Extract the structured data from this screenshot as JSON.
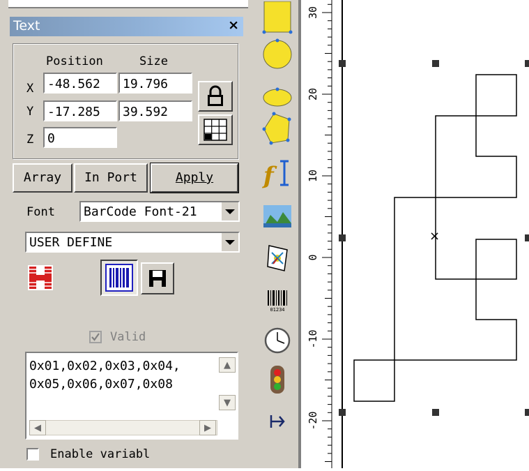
{
  "panel": {
    "title": "Text",
    "close": "×",
    "position_header": "Position",
    "size_header": "Size",
    "x_label": "X",
    "y_label": "Y",
    "z_label": "Z",
    "x_position": "-48.562",
    "x_size": "19.796",
    "y_position": "-17.285",
    "y_size": "39.592",
    "z_value": "0",
    "array_label": "Array",
    "inport_label": "In Port",
    "apply_label": "Apply",
    "font_label": "Font",
    "font_value": "BarCode Font-21",
    "barcode_type": "USER DEFINE",
    "valid_label": "Valid",
    "memo_text": "0x01,0x02,0x03,0x04,\n0x05,0x06,0x07,0x08",
    "enable_label": "Enable variabl"
  },
  "ruler": {
    "labels": [
      "30",
      "20",
      "10",
      "0",
      "-10",
      "-20"
    ]
  },
  "canvas": {
    "center_marker": "×"
  },
  "tools": [
    "rectangle-tool",
    "circle-tool",
    "ellipse-tool",
    "polygon-tool",
    "text-tool",
    "bitmap-tool",
    "vector-file-tool",
    "barcode-tool",
    "clock-tool",
    "signal-light-tool",
    "extend-axis-tool"
  ],
  "colors": {
    "title_bar": "#8fb0d6",
    "panel_bg": "#d4d0c8",
    "shape_yellow": "#f5e02a"
  }
}
